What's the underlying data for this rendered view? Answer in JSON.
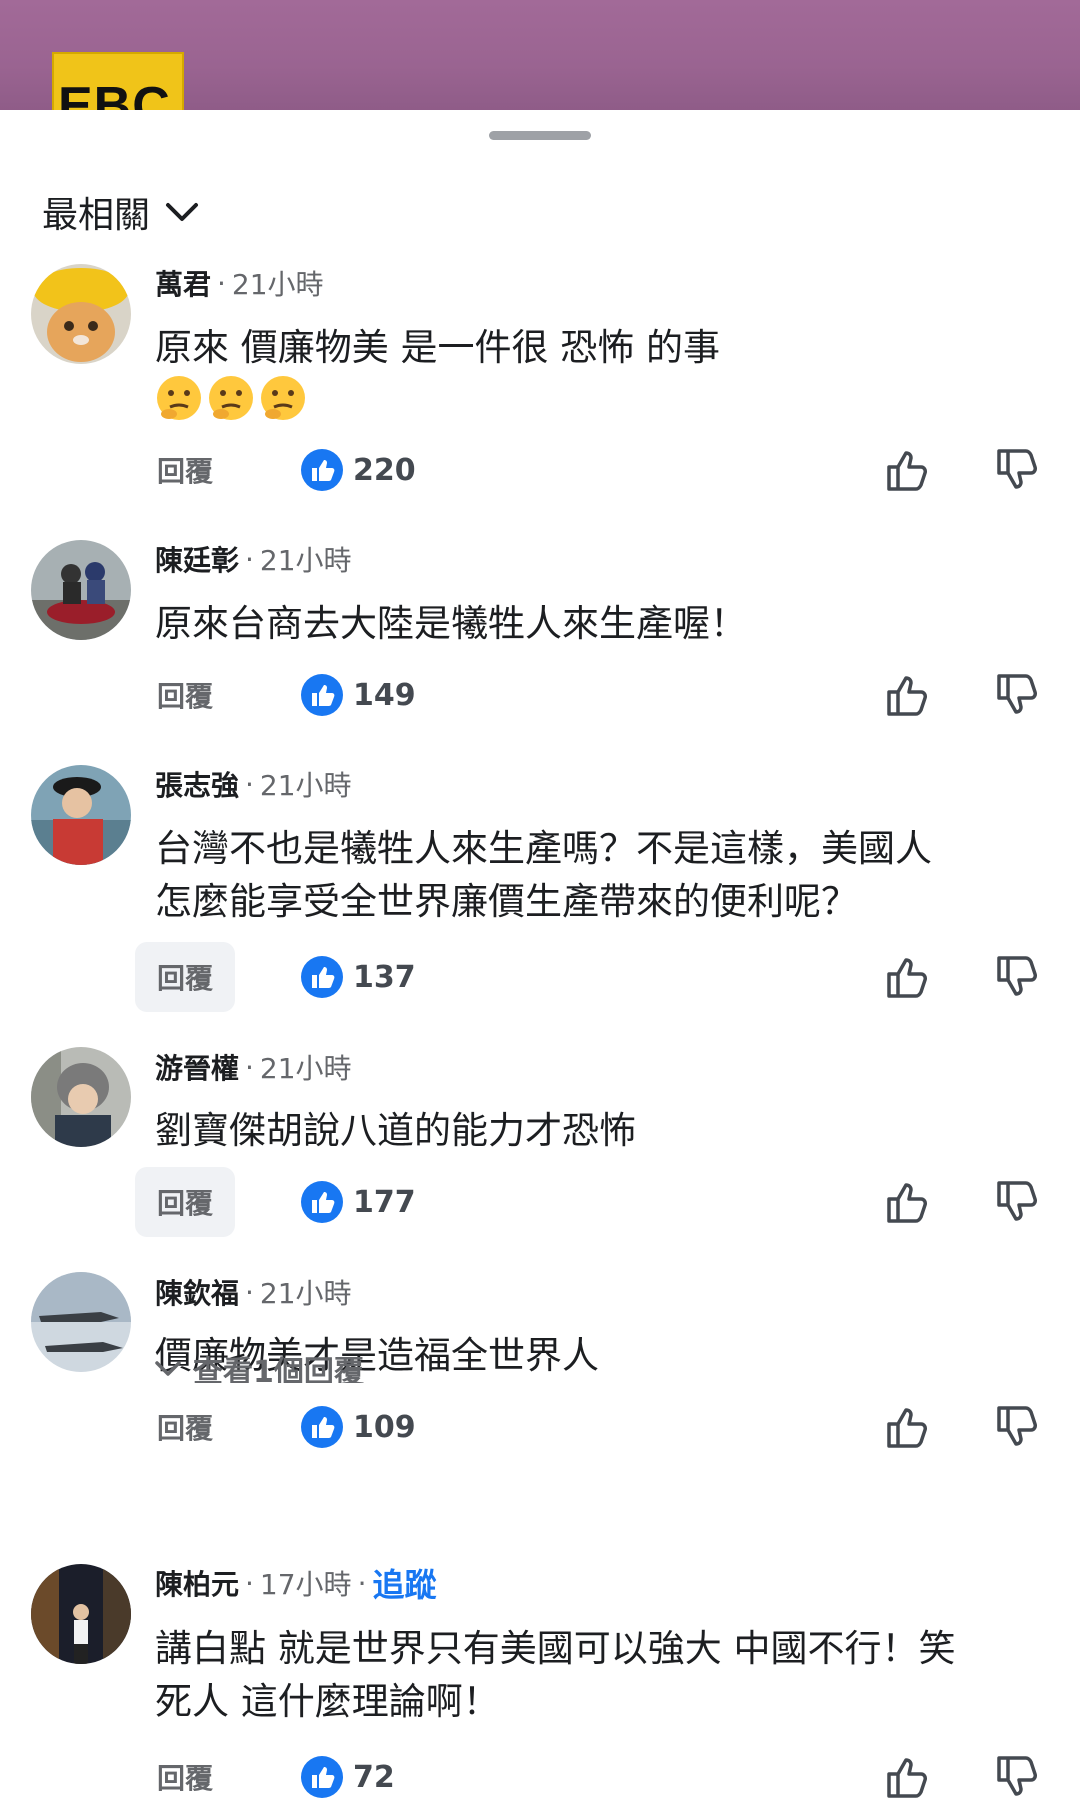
{
  "video": {
    "channel_logo_text": "EBC"
  },
  "sort": {
    "label": "最相關"
  },
  "comments": [
    {
      "author": "萬君",
      "time": "21小時",
      "text": "原來 價廉物美 是一件很 恐怖 的事",
      "emoji": "🤔🤔🤔",
      "reply_label": "回覆",
      "likes": "220"
    },
    {
      "author": "陳廷彰",
      "time": "21小時",
      "text": "原來台商去大陸是犧牲人來生產喔！",
      "reply_label": "回覆",
      "likes": "149"
    },
    {
      "author": "張志強",
      "time": "21小時",
      "text": "台灣不也是犧牲人來生產嗎？不是這樣，美國人\n怎麼能享受全世界廉價生產帶來的便利呢？",
      "reply_label": "回覆",
      "likes": "137"
    },
    {
      "author": "游晉權",
      "time": "21小時",
      "text": "劉寶傑胡說八道的能力才恐怖",
      "reply_label": "回覆",
      "likes": "177"
    },
    {
      "author": "陳欽福",
      "time": "21小時",
      "text": "價廉物美才是造福全世界人",
      "reply_label": "回覆",
      "likes": "109",
      "view_replies": "查看1個回覆"
    },
    {
      "author": "陳柏元",
      "time": "17小時",
      "follow": "追蹤",
      "text": "講白點 就是世界只有美國可以強大 中國不行！笑\n死人 這什麼理論啊！",
      "reply_label": "回覆",
      "likes": "72"
    }
  ],
  "colors": {
    "accent": "#1877f2",
    "video_bg": "#9a6491",
    "muted": "#65676b"
  },
  "icons": [
    "chevron-down-icon",
    "like-reaction-icon",
    "thumbs-up-icon",
    "thumbs-down-icon"
  ]
}
